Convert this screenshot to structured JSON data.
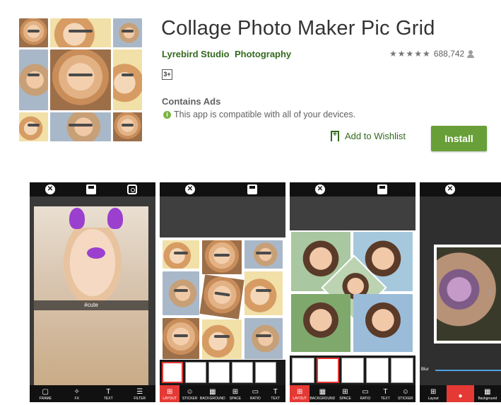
{
  "app": {
    "title": "Collage Photo Maker Pic Grid",
    "developer": "Lyrebird Studio",
    "category": "Photography",
    "rating_count": "688,742",
    "rating_value": 4.5,
    "content_rating": "3+",
    "contains_ads": "Contains Ads",
    "compatibility": "This app is compatible with all of your devices.",
    "wishlist_label": "Add to Wishlist",
    "install_label": "Install",
    "stars_glyph": "★★★★★"
  },
  "colors": {
    "accent_green": "#689f38",
    "link_green": "#33691e",
    "active_tool": "#e53935"
  },
  "screenshots": [
    {
      "caption": "#cute",
      "toolbar": [
        "FRAME",
        "FX",
        "TEXT",
        "FILTER"
      ],
      "toolbar_icons": [
        "frame-icon",
        "fx-icon",
        "text-icon",
        "filter-icon"
      ]
    },
    {
      "toolbar": [
        "LAYOUT",
        "STICKER",
        "BACKGROUND",
        "SPACE",
        "RATIO",
        "TEXT"
      ],
      "toolbar_icons": [
        "layout-icon",
        "sticker-icon",
        "background-icon",
        "space-icon",
        "ratio-icon",
        "text-icon"
      ],
      "active": "LAYOUT"
    },
    {
      "toolbar": [
        "LAYOUT",
        "BACKGROUND",
        "SPACE",
        "RATIO",
        "TEXT",
        "STICKER"
      ],
      "toolbar_icons": [
        "layout-icon",
        "background-icon",
        "space-icon",
        "ratio-icon",
        "text-icon",
        "sticker-icon"
      ],
      "active": "LAYOUT"
    },
    {
      "slider_label": "Blur",
      "toolbar": [
        "Layout",
        "",
        "Background"
      ],
      "toolbar_icons": [
        "layout-icon",
        "blur-icon",
        "background-icon"
      ],
      "active": ""
    }
  ]
}
